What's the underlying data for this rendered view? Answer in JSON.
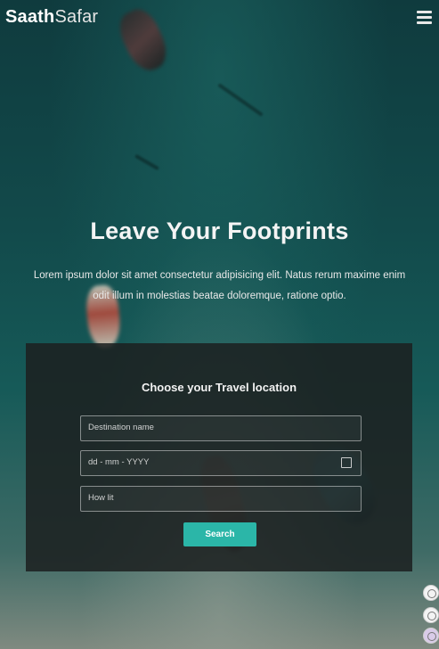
{
  "brand": {
    "name_bold": "Saath",
    "name_light": "Safar"
  },
  "header": {
    "menu_icon": "hamburger-menu-icon"
  },
  "hero": {
    "title": "Leave Your Footprints",
    "text": "Lorem ipsum dolor sit amet consectetur adipisicing elit. Natus rerum maxime enim odit illum in molestias beatae doloremque, ratione optio."
  },
  "form": {
    "title": "Choose your Travel location",
    "destination_placeholder": "Destination name",
    "date_placeholder": "dd - mm - YYYY",
    "people_placeholder": "How lit",
    "search_label": "Search",
    "accent_color": "#2bb6a8"
  },
  "side_buttons": [
    "chat-icon",
    "settings-icon",
    "user-icon"
  ]
}
